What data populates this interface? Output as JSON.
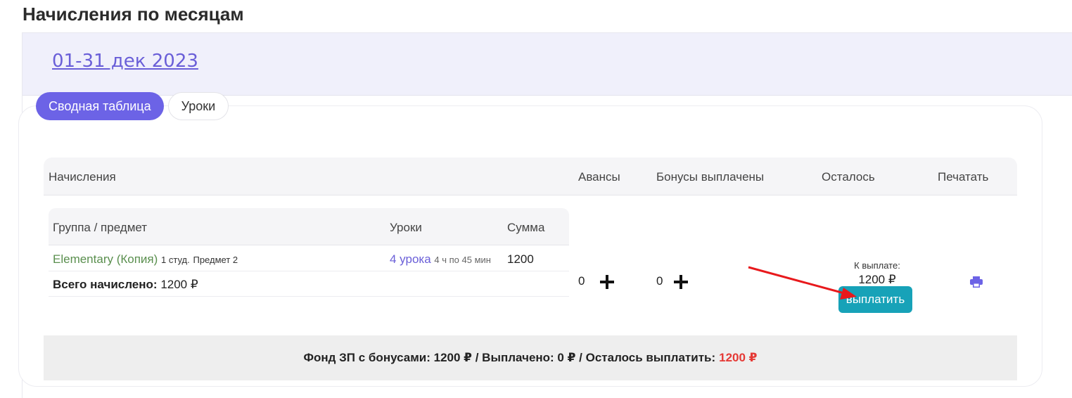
{
  "page": {
    "title": "Начисления по месяцам"
  },
  "period": {
    "label": "01-31 дек 2023"
  },
  "tabs": [
    {
      "label": "Сводная таблица",
      "active": true
    },
    {
      "label": "Уроки",
      "active": false
    }
  ],
  "table": {
    "headers": {
      "accruals": "Начисления",
      "advances": "Авансы",
      "bonuses": "Бонусы выплачены",
      "remaining": "Осталось",
      "print": "Печатать"
    },
    "inner": {
      "headers": {
        "group": "Группа / предмет",
        "lessons": "Уроки",
        "sum": "Сумма"
      },
      "rows": [
        {
          "group": "Elementary (Копия)",
          "students": "1 студ.",
          "subject": "Предмет 2",
          "lessons": "4 урока",
          "duration": "4 ч по 45 мин",
          "sum": "1200"
        }
      ],
      "total_label": "Всего начислено:",
      "total_value": "1200 ₽"
    },
    "advances_value": "0",
    "bonuses_value": "0",
    "to_pay_label": "К выплате:",
    "to_pay_amount": "1200 ₽",
    "pay_button": "выплатить"
  },
  "summary": {
    "text": "Фонд ЗП с бонусами: 1200 ₽ / Выплачено: 0 ₽ / Осталось выплатить:",
    "remaining": "1200 ₽"
  },
  "icons": {
    "add": "plus-icon",
    "print": "printer-icon"
  },
  "colors": {
    "accent": "#6c63e6",
    "pay_button": "#17a2b8",
    "remaining": "#e53935",
    "group_link": "#5a8f4e",
    "annotation_arrow": "#e8191c"
  }
}
